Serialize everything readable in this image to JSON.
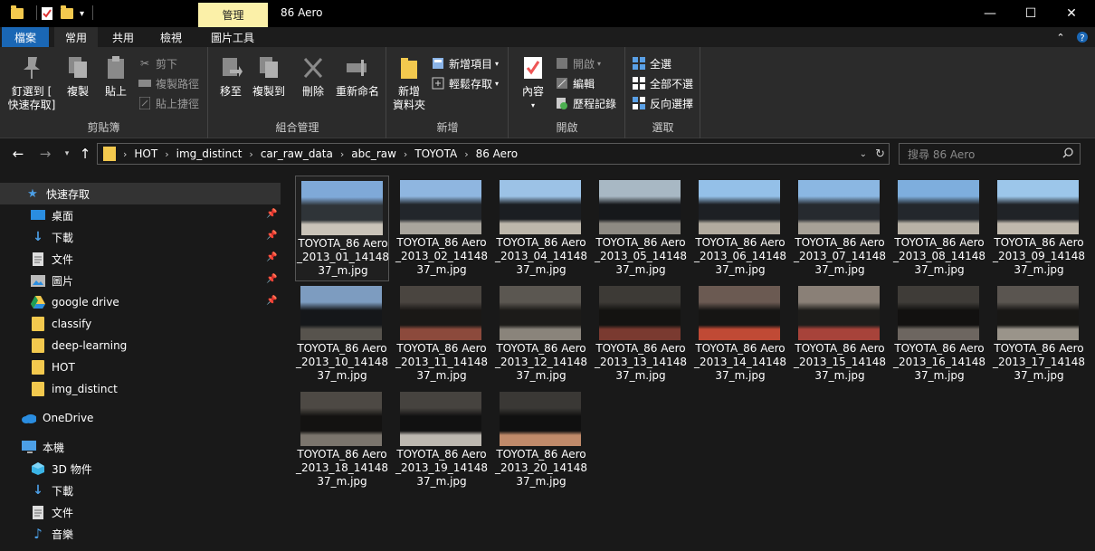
{
  "window": {
    "title": "86 Aero",
    "context_tab": "管理",
    "minimize": "—",
    "maximize": "☐",
    "close": "✕"
  },
  "ribbon_tabs": [
    "檔案",
    "常用",
    "共用",
    "檢視",
    "圖片工具"
  ],
  "ribbon": {
    "clipboard": {
      "label": "剪貼簿",
      "pin": "釘選到 [\n快速存取]",
      "copy": "複製",
      "paste": "貼上",
      "cut": "剪下",
      "copy_path": "複製路徑",
      "paste_shortcut": "貼上捷徑"
    },
    "organize": {
      "label": "組合管理",
      "move_to": "移至",
      "copy_to": "複製到",
      "delete": "刪除",
      "rename": "重新命名"
    },
    "new": {
      "label": "新增",
      "new_folder": "新增\n資料夾",
      "new_item": "新增項目",
      "easy_access": "輕鬆存取"
    },
    "open": {
      "label": "開啟",
      "properties": "內容",
      "open": "開啟",
      "edit": "編輯",
      "history": "歷程記錄"
    },
    "select": {
      "label": "選取",
      "select_all": "全選",
      "select_none": "全部不選",
      "invert": "反向選擇"
    }
  },
  "address": {
    "breadcrumbs": [
      "HOT",
      "img_distinct",
      "car_raw_data",
      "abc_raw",
      "TOYOTA",
      "86 Aero"
    ],
    "search_placeholder": "搜尋 86 Aero"
  },
  "nav": {
    "quick_access": "快速存取",
    "pinned": [
      "桌面",
      "下載",
      "文件",
      "圖片",
      "google drive"
    ],
    "folders": [
      "classify",
      "deep-learning",
      "HOT",
      "img_distinct"
    ],
    "onedrive": "OneDrive",
    "this_pc": "本機",
    "pc_items": [
      "3D 物件",
      "下載",
      "文件",
      "音樂"
    ]
  },
  "files": [
    {
      "name": "TOYOTA_86 Aero_2013_01_1414837_m.jpg",
      "colors": [
        "#7fa9d8",
        "#2f3438",
        "#c9c3b8"
      ]
    },
    {
      "name": "TOYOTA_86 Aero_2013_02_1414837_m.jpg",
      "colors": [
        "#8fb6e0",
        "#22262b",
        "#a9a59d"
      ]
    },
    {
      "name": "TOYOTA_86 Aero_2013_04_1414837_m.jpg",
      "colors": [
        "#9cc2e6",
        "#1b1e22",
        "#bdb7ab"
      ]
    },
    {
      "name": "TOYOTA_86 Aero_2013_05_1414837_m.jpg",
      "colors": [
        "#a8b8c4",
        "#16181b",
        "#8e8a83"
      ]
    },
    {
      "name": "TOYOTA_86 Aero_2013_06_1414837_m.jpg",
      "colors": [
        "#94c0e8",
        "#1d2024",
        "#b2ab9f"
      ]
    },
    {
      "name": "TOYOTA_86 Aero_2013_07_1414837_m.jpg",
      "colors": [
        "#8bb7e2",
        "#262a2f",
        "#a7a197"
      ]
    },
    {
      "name": "TOYOTA_86 Aero_2013_08_1414837_m.jpg",
      "colors": [
        "#7eaedd",
        "#23272c",
        "#b8b2a6"
      ]
    },
    {
      "name": "TOYOTA_86 Aero_2013_09_1414837_m.jpg",
      "colors": [
        "#9cc6ea",
        "#202327",
        "#c0b9ad"
      ]
    },
    {
      "name": "TOYOTA_86 Aero_2013_10_1414837_m.jpg",
      "colors": [
        "#7d9cc0",
        "#15171a",
        "#57534d"
      ]
    },
    {
      "name": "TOYOTA_86 Aero_2013_11_1414837_m.jpg",
      "colors": [
        "#4a4540",
        "#1a1816",
        "#8c4a3c"
      ]
    },
    {
      "name": "TOYOTA_86 Aero_2013_12_1414837_m.jpg",
      "colors": [
        "#5b5751",
        "#1c1b19",
        "#8a847b"
      ]
    },
    {
      "name": "TOYOTA_86 Aero_2013_13_1414837_m.jpg",
      "colors": [
        "#3d3a36",
        "#141311",
        "#7a3a30"
      ]
    },
    {
      "name": "TOYOTA_86 Aero_2013_14_1414837_m.jpg",
      "colors": [
        "#6b5a52",
        "#161514",
        "#c04a35"
      ]
    },
    {
      "name": "TOYOTA_86 Aero_2013_15_1414837_m.jpg",
      "colors": [
        "#8a8077",
        "#1e1d1b",
        "#a7433a"
      ]
    },
    {
      "name": "TOYOTA_86 Aero_2013_16_1414837_m.jpg",
      "colors": [
        "#3f3c38",
        "#121110",
        "#6d6660"
      ]
    },
    {
      "name": "TOYOTA_86 Aero_2013_17_1414837_m.jpg",
      "colors": [
        "#5a5550",
        "#181715",
        "#9a948a"
      ]
    },
    {
      "name": "TOYOTA_86 Aero_2013_18_1414837_m.jpg",
      "colors": [
        "#4d4944",
        "#131211",
        "#7b756d"
      ]
    },
    {
      "name": "TOYOTA_86 Aero_2013_19_1414837_m.jpg",
      "colors": [
        "#46433f",
        "#111",
        "#bdb8b0"
      ]
    },
    {
      "name": "TOYOTA_86 Aero_2013_20_1414837_m.jpg",
      "colors": [
        "#3a3835",
        "#101010",
        "#c08a6a"
      ]
    }
  ],
  "colors": {
    "file_tab": "#1a67b5",
    "context_tab": "#fbf0a8",
    "folder": "#f3c94e",
    "onedrive": "#2a8de0"
  }
}
